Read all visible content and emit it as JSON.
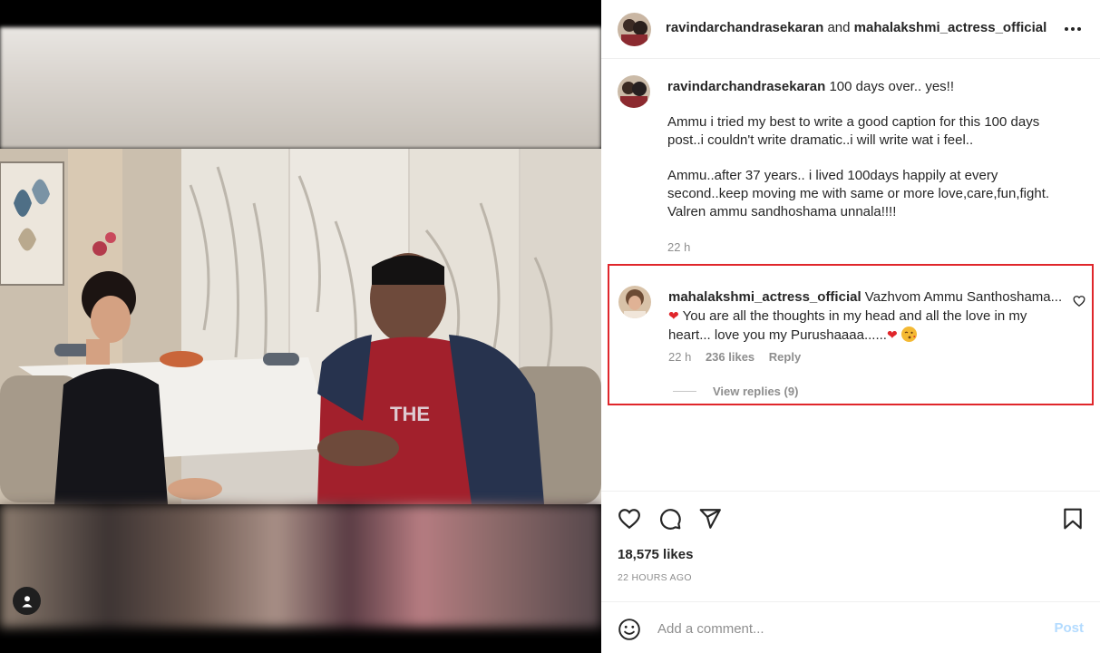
{
  "post": {
    "author_primary": "ravindarchandrasekaran",
    "author_joiner": "and",
    "author_collab": "mahalakshmi_actress_official",
    "more_icon": "more-horizontal-icon",
    "tag_icon": "user-tag-icon"
  },
  "caption": {
    "username": "ravindarchandrasekaran",
    "headline": "100 days over.. yes!!",
    "paragraph_1": "Ammu i tried my best to write a good caption for this 100 days post..i couldn't write dramatic..i will write wat i feel..",
    "paragraph_2": "Ammu..after 37 years.. i lived 100days happily at every second..keep moving me with same or more love,care,fun,fight. Valren ammu sandhoshama unnala!!!!",
    "time": "22 h"
  },
  "comment": {
    "username": "mahalakshmi_actress_official",
    "text_1": "Vazhvom Ammu Santhoshama...",
    "heart_1": "❤",
    "text_2": "You are all the thoughts in my head and all the love in my heart... love you my Purushaaaa......",
    "heart_2": "❤",
    "time": "22 h",
    "likes": "236 likes",
    "reply": "Reply",
    "view_replies": "View replies (9)",
    "highlight_color": "#e0262b"
  },
  "actions": {
    "like_icon": "heart-icon",
    "comment_icon": "comment-icon",
    "share_icon": "send-icon",
    "save_icon": "bookmark-icon",
    "likes": "18,575 likes",
    "posted_ago": "22 HOURS AGO"
  },
  "add_comment": {
    "placeholder": "Add a comment...",
    "post_label": "Post",
    "emoji_icon": "smiley-icon"
  }
}
